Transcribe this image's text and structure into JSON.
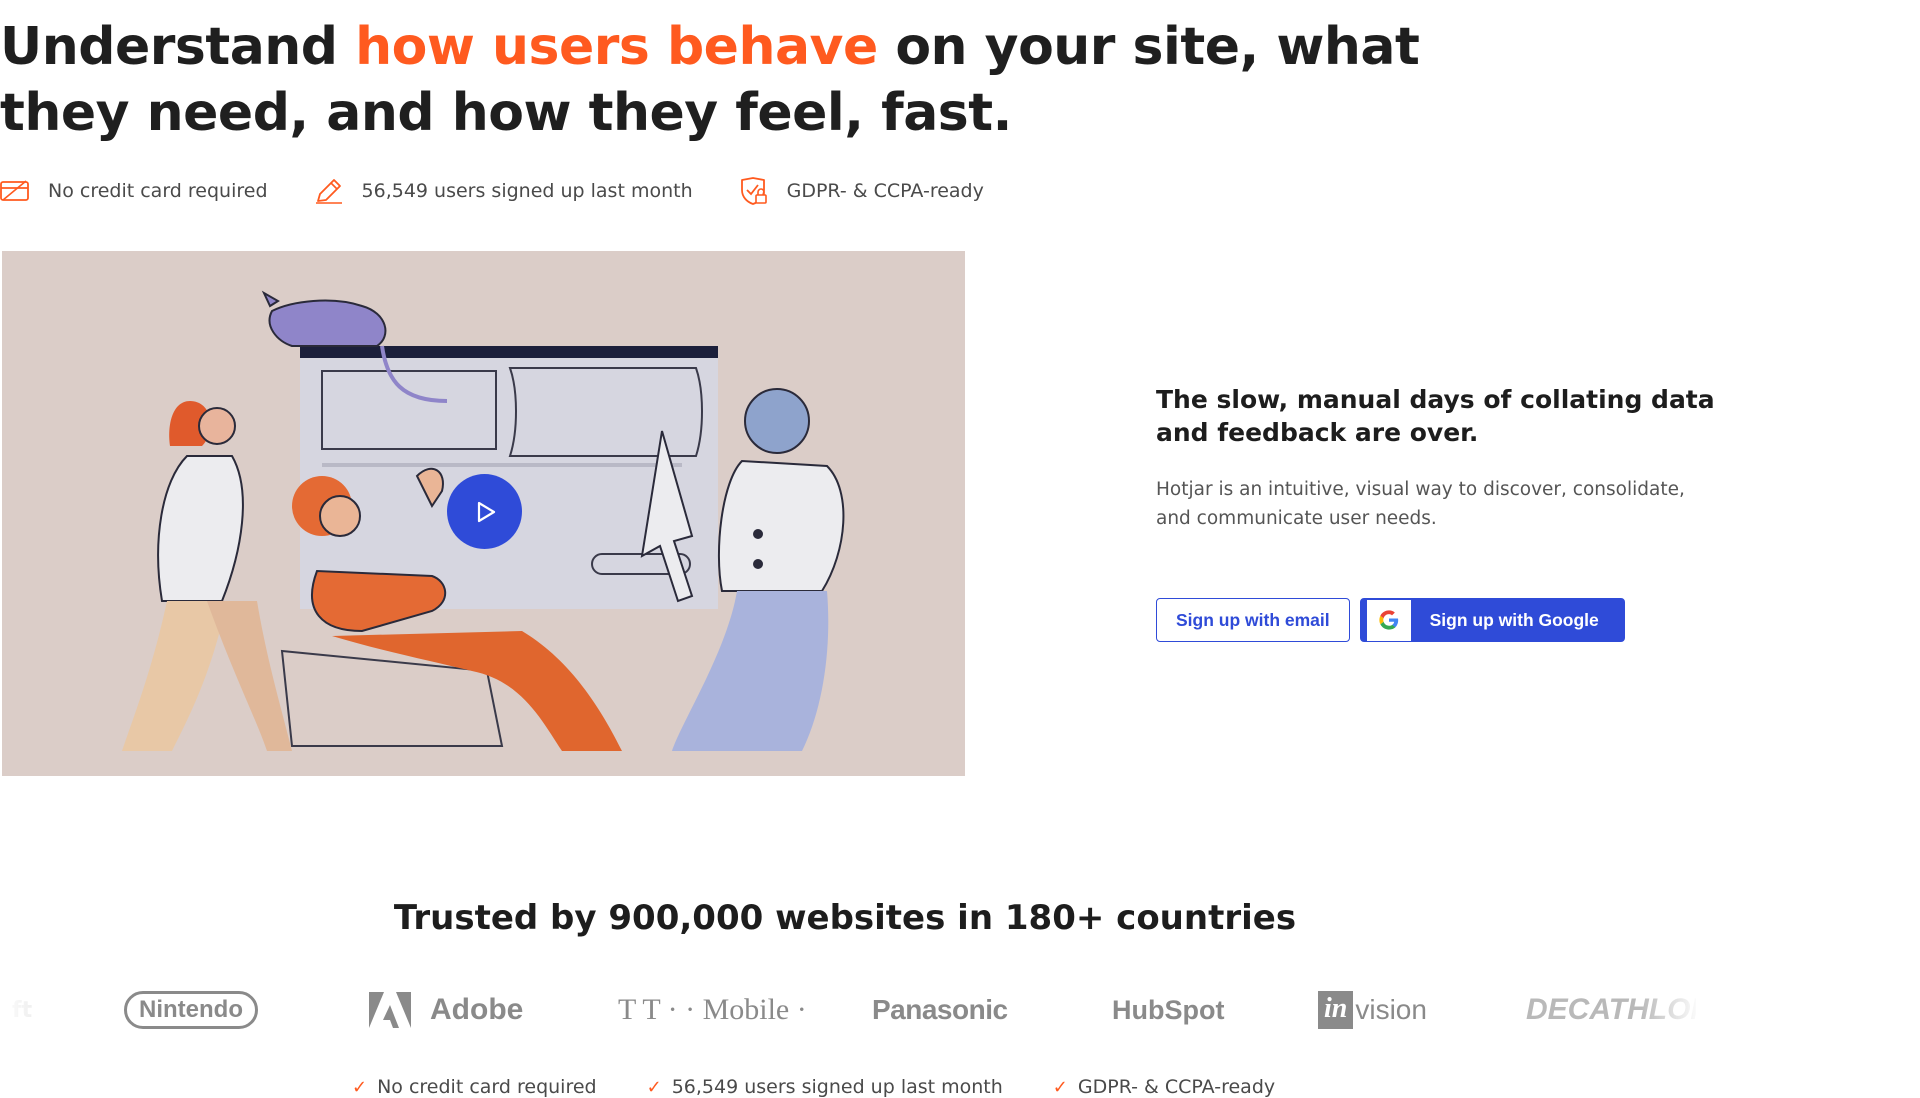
{
  "hero": {
    "title_part1": "Understand ",
    "title_accent": "how users behave",
    "title_part2": " on your site, what they need, and how they feel, fast."
  },
  "trust_badges": [
    {
      "icon": "credit-card-icon",
      "label": "No credit card required"
    },
    {
      "icon": "pencil-icon",
      "label": "56,549 users signed up last month"
    },
    {
      "icon": "shield-lock-icon",
      "label": "GDPR- & CCPA-ready"
    }
  ],
  "video": {
    "play_icon": "play-icon"
  },
  "copy": {
    "title": "The slow, manual days of collating data and feedback are over.",
    "text": "Hotjar is an intuitive, visual way to discover, consolidate, and communicate user needs."
  },
  "cta": {
    "email_label": "Sign up with email",
    "google_label": "Sign up with Google"
  },
  "trusted": {
    "heading": "Trusted by 900,000 websites in 180+ countries",
    "logos": [
      "Nintendo",
      "Adobe",
      "T · · Mobile ·",
      "Panasonic",
      "HubSpot",
      "in",
      "vision",
      "DECATHLON"
    ]
  },
  "colors": {
    "accent": "#ff5a1f",
    "primary": "#2f4bd8",
    "illustration_bg": "#dbcdc8"
  }
}
